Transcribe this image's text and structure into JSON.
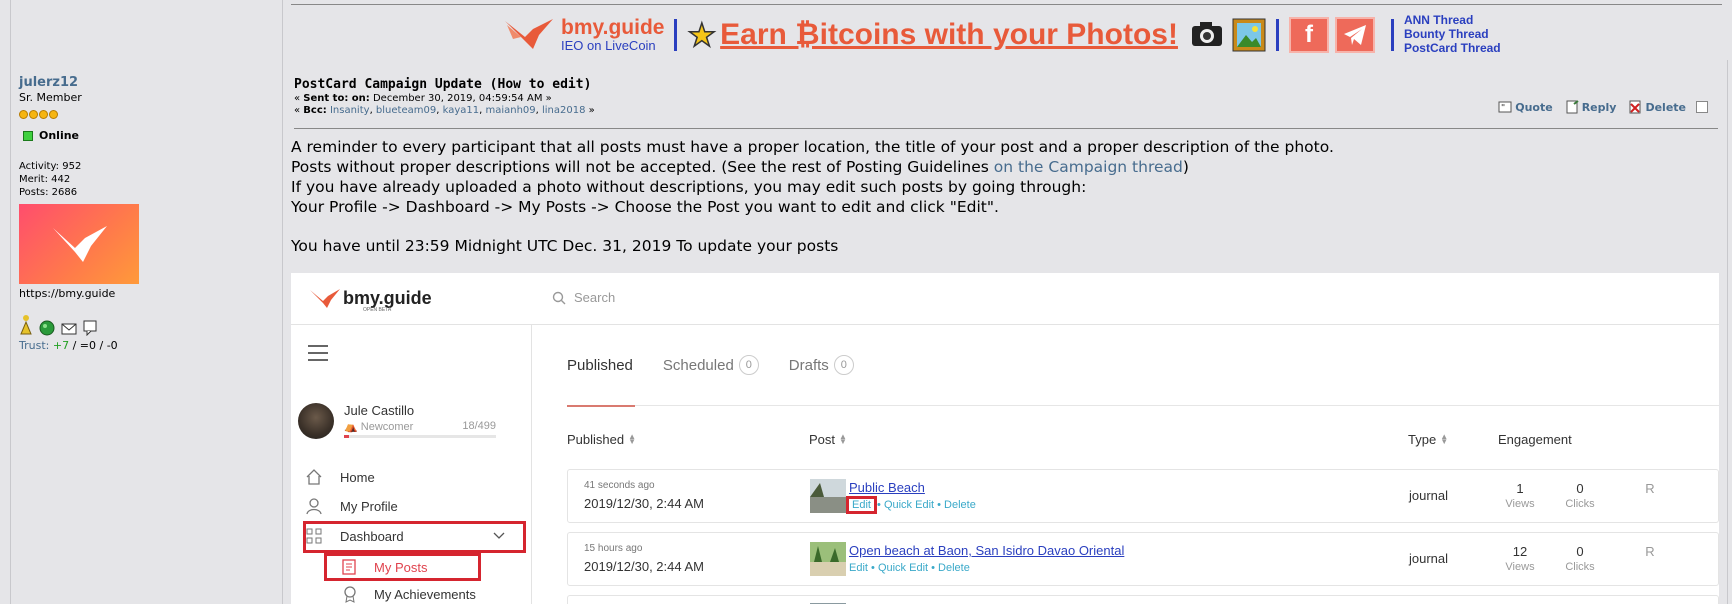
{
  "banner": {
    "brand": "bmy.guide",
    "ieo": "IEO on LiveCoin",
    "headline": "Earn ₿itcoins with your Photos!",
    "threads": [
      "ANN Thread",
      "Bounty Thread",
      "PostCard Thread"
    ],
    "social_f": "f"
  },
  "poster": {
    "name": "julerz12",
    "rank": "Sr. Member",
    "status": "Online",
    "activity": "Activity: 952",
    "merit": "Merit: 442",
    "posts": "Posts: 2686",
    "url": "https://bmy.guide",
    "trust_label": "Trust:",
    "trust_pos": "+7",
    "trust_rest": " / =0 / -0"
  },
  "message": {
    "subject": "PostCard Campaign Update (How to edit)",
    "sent_prefix": "« ",
    "sent_label": "Sent to: on:",
    "sent_value": " December 30, 2019, 04:59:54 AM »",
    "bcc_label": "Bcc:",
    "bcc": [
      "Insanity",
      "blueteam09",
      "kaya11",
      "maianh09",
      "lina2018"
    ],
    "actions": {
      "quote": "Quote",
      "reply": "Reply",
      "delete": "Delete"
    }
  },
  "body": {
    "line1": "A reminder to every participant that all posts must have a proper location, the title of your post and a proper description of the photo.",
    "line2_pre": "Posts without proper descriptions will not be accepted. (See the rest of Posting Guidelines ",
    "line2_link": "on the Campaign thread",
    "line2_post": ")",
    "line3": "If you have already uploaded a photo without descriptions, you may edit such posts by going through:",
    "line4": "Your Profile -> Dashboard -> My Posts -> Choose the Post you want to edit and click \"Edit\".",
    "deadline": "You have until 23:59 Midnight UTC Dec. 31, 2019 To update your posts"
  },
  "shot": {
    "logo": "bmy.guide",
    "logo_sub": "OPEN BETA",
    "search_placeholder": "Search",
    "user": {
      "name": "Jule Castillo",
      "rank": "Newcomer",
      "progress": "18/499",
      "progress_fraction": 0.036
    },
    "nav": [
      "Home",
      "My Profile",
      "Dashboard",
      "My Posts",
      "My Achievements"
    ],
    "tabs": [
      {
        "label": "Published",
        "count": ""
      },
      {
        "label": "Scheduled",
        "count": "0"
      },
      {
        "label": "Drafts",
        "count": "0"
      }
    ],
    "columns": {
      "published": "Published",
      "post": "Post",
      "type": "Type",
      "engagement": "Engagement"
    },
    "rows": [
      {
        "ago": "41 seconds ago",
        "date": "2019/12/30, 2:44 AM",
        "title": "Public Beach",
        "edit": "Edit",
        "quick_edit": "Quick Edit",
        "delete": "Delete",
        "type": "journal",
        "views": "1",
        "views_label": "Views",
        "clicks": "0",
        "clicks_label": "Clicks",
        "r": "R"
      },
      {
        "ago": "15 hours ago",
        "date": "2019/12/30, 2:44 AM",
        "title": "Open beach at Baon, San Isidro Davao Oriental",
        "edit": "Edit",
        "quick_edit": "Quick Edit",
        "delete": "Delete",
        "type": "journal",
        "views": "12",
        "views_label": "Views",
        "clicks": "0",
        "clicks_label": "Clicks",
        "r": "R"
      }
    ]
  }
}
